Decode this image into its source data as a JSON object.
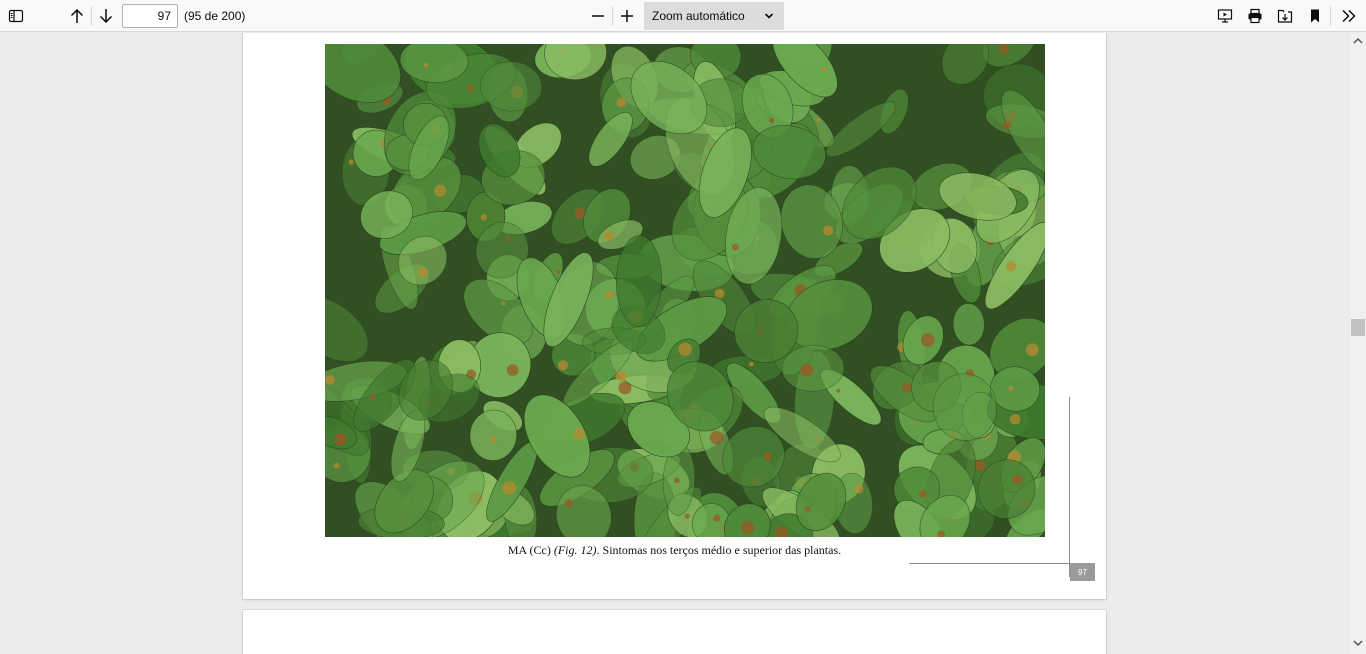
{
  "toolbar": {
    "page_number": "97",
    "page_count": "(95 de 200)",
    "zoom_label": "Zoom automático",
    "icons": [
      "sidebar-toggle-icon",
      "arrow-up-icon",
      "arrow-down-icon",
      "minus-icon",
      "plus-icon",
      "chevron-down-icon",
      "presentation-icon",
      "print-icon",
      "download-icon",
      "bookmark-icon",
      "double-chevron-right-icon"
    ]
  },
  "document": {
    "caption_prefix": "MA (Cc) ",
    "caption_fig": "(Fig. 12)",
    "caption_text": ". Sintomas nos terços médio e superior das plantas.",
    "page_label": "97"
  },
  "colors": {
    "toolbar_bg": "#f9f9fa",
    "viewer_bg": "#ececee",
    "zoom_bg": "#dcdcde",
    "icon": "#0c0c0d"
  }
}
